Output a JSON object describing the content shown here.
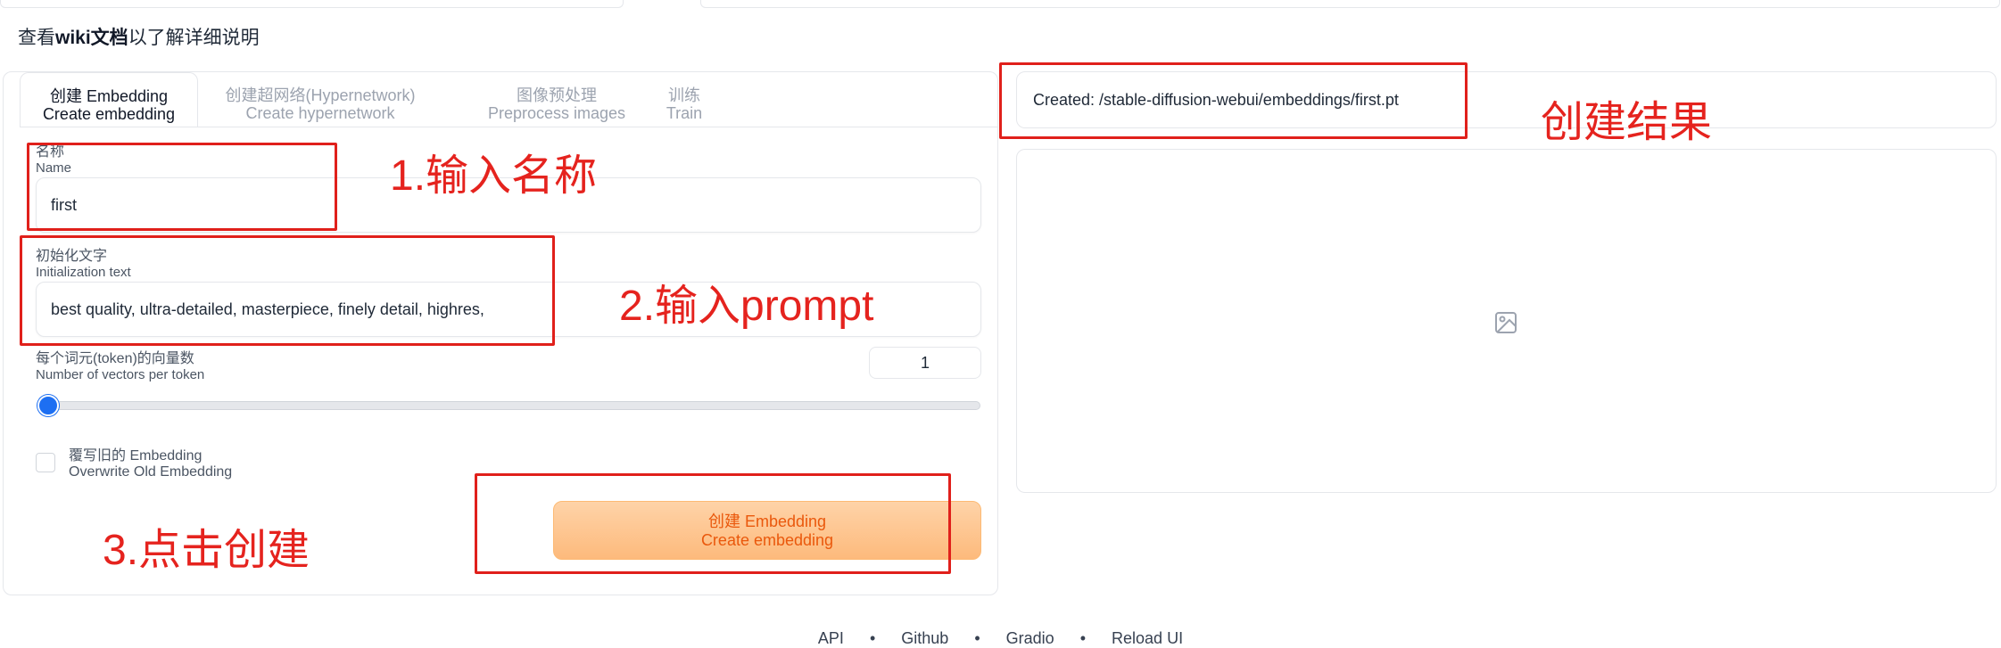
{
  "wiki": {
    "prefix": "查看",
    "bold": "wiki文档",
    "suffix": "以了解详细说明"
  },
  "tabs": [
    {
      "zh": "创建 Embedding",
      "en": "Create embedding",
      "active": true
    },
    {
      "zh": "创建超网络(Hypernetwork)",
      "en": "Create hypernetwork",
      "active": false
    },
    {
      "zh": "图像预处理",
      "en": "Preprocess images",
      "active": false
    },
    {
      "zh": "训练",
      "en": "Train",
      "active": false
    }
  ],
  "name_field": {
    "label_zh": "名称",
    "label_en": "Name",
    "value": "first"
  },
  "init_field": {
    "label_zh": "初始化文字",
    "label_en": "Initialization text",
    "value": "best quality, ultra-detailed, masterpiece, finely detail, highres,"
  },
  "vectors": {
    "label_zh": "每个词元(token)的向量数",
    "label_en": "Number of vectors per token",
    "value": "1",
    "slider_fraction": 0.0
  },
  "overwrite": {
    "label_zh": "覆写旧的 Embedding",
    "label_en": "Overwrite Old Embedding",
    "checked": false
  },
  "create_button": {
    "zh": "创建 Embedding",
    "en": "Create embedding"
  },
  "result": {
    "text": "Created: /stable-diffusion-webui/embeddings/first.pt"
  },
  "annotations": {
    "step1": "1.输入名称",
    "step2": "2.输入prompt",
    "step3": "3.点击创建",
    "result": "创建结果"
  },
  "footer": [
    "API",
    "•",
    "Github",
    "•",
    "Gradio",
    "•",
    "Reload UI"
  ],
  "colors": {
    "annotation_red": "#e5231e",
    "button_orange": "#fdba7c",
    "slider_blue": "#1d6ff2"
  },
  "icons": {
    "image_placeholder": "image-icon"
  }
}
